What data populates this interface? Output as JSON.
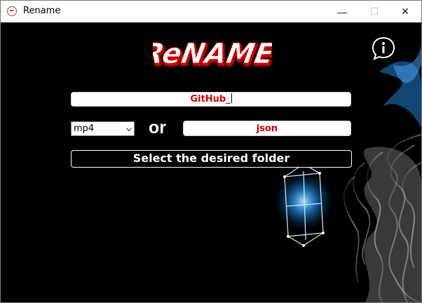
{
  "window": {
    "title": "Rename",
    "minimize_glyph": "—",
    "maximize_glyph": "☐",
    "close_glyph": "✕"
  },
  "logo": {
    "text": "ReNAME"
  },
  "info": {
    "icon": "info-speech-bubble-icon"
  },
  "name_field": {
    "value": "GitHub_"
  },
  "ext_select": {
    "selected": "mp4"
  },
  "or_label": "or",
  "ext_field": {
    "value": "json"
  },
  "folder_button": {
    "label": "Select the desired folder"
  },
  "colors": {
    "accent_red": "#d40000",
    "background": "#000000",
    "field_bg": "#ffffff",
    "glow_blue": "#2fa8ff"
  }
}
